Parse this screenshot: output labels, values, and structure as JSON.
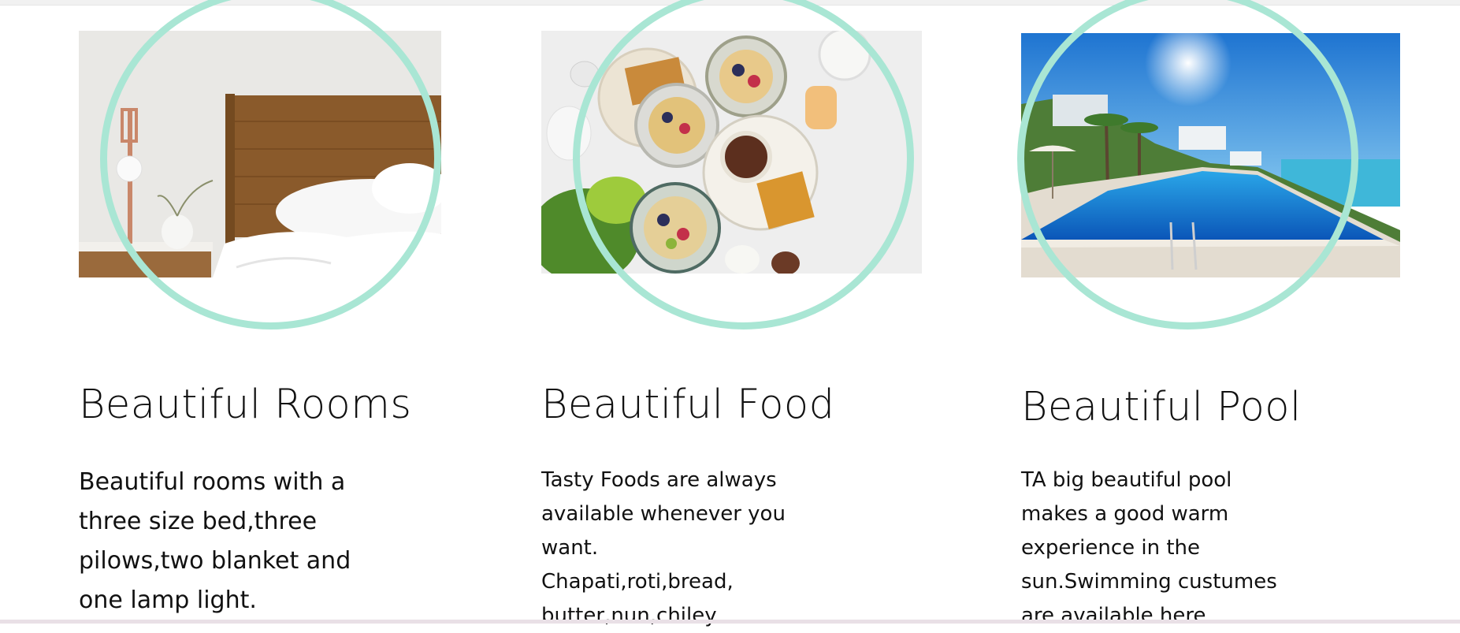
{
  "features": [
    {
      "image": "bedroom-photo",
      "title": "Beautiful Rooms",
      "description": "Beautiful rooms with a\nthree size bed,three\npilows,two blanket and\none lamp light."
    },
    {
      "image": "food-photo",
      "title": "Beautiful Food",
      "description": "Tasty Foods are always\navailable whenever you\nwant.\nChapati,roti,bread,\nbutter,nun,chiley"
    },
    {
      "image": "pool-photo",
      "title": "Beautiful Pool",
      "description": "TA big beautiful pool\nmakes a good warm\nexperience in the\nsun.Swimming custumes\nare available here"
    }
  ],
  "colors": {
    "ring": "#a9e6d4",
    "text": "#111111",
    "background": "#ffffff"
  }
}
